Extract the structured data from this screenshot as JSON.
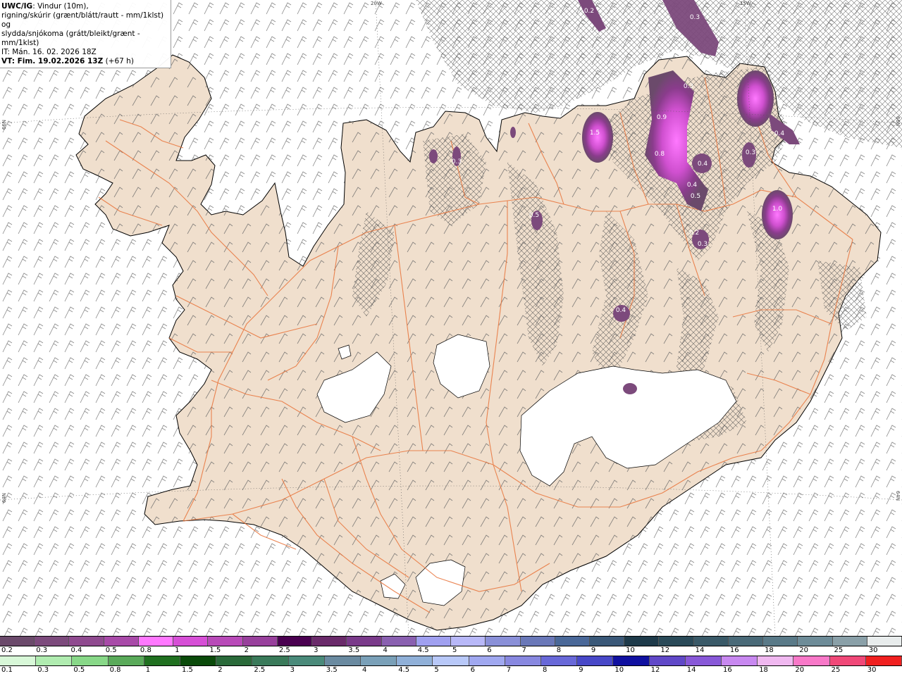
{
  "header": {
    "model": "UWC/IG",
    "line1": ": Vindur (10m),",
    "line2": "rigning/skúrir (grænt/blátt/rautt - mm/1klst) og",
    "line3": "slydda/snjókoma (grátt/bleikt/grænt - mm/1klst)",
    "it": "IT: Mán. 16. 02. 2026 18Z",
    "vt": "VT: Fim. 19.02.2026 13Z",
    "vt_suffix": " (+67 h)"
  },
  "coords": {
    "top_20w": "20W",
    "top_15w": "15W",
    "left_66n": "66N",
    "right_66n": "66N",
    "left_64n": "64N",
    "right_64n": "64N"
  },
  "colors": {
    "land": "#f0dfcd",
    "roads": "#e8733a",
    "glacier": "#ffffff",
    "snow_light": "#7d4b7f",
    "snow_mid": "#a64aa6",
    "snow_high": "#e65fe6",
    "ocean": "#ffffff"
  },
  "legend": {
    "snow": {
      "labels": [
        "0.2",
        "0.3",
        "0.4",
        "0.5",
        "0.8",
        "1",
        "1.5",
        "2",
        "2.5",
        "3",
        "3.5",
        "4",
        "4.5",
        "5",
        "6",
        "7",
        "8",
        "9",
        "10",
        "12",
        "14",
        "16",
        "18",
        "20",
        "25",
        "30"
      ],
      "colors": [
        "#6b4a6b",
        "#7c4a7c",
        "#8f4a8f",
        "#a84aa8",
        "#ff78ff",
        "#d64fd6",
        "#b84ab8",
        "#98409c",
        "#4a0050",
        "#6a2a6a",
        "#7a3a8a",
        "#8a60b0",
        "#a0a0f0",
        "#b8b8f8",
        "#8a90d8",
        "#6a78b8",
        "#4a6898",
        "#3a5878",
        "#1e3a4a",
        "#2a4a58",
        "#3a5a68",
        "#4a6a78",
        "#5a7a88",
        "#6e8c98",
        "#8aa0a8",
        "#e8ecec"
      ]
    },
    "rain": {
      "labels": [
        "0.1",
        "0.3",
        "0.5",
        "0.8",
        "1",
        "1.5",
        "2",
        "2.5",
        "3",
        "3.5",
        "4",
        "4.5",
        "5",
        "6",
        "7",
        "8",
        "9",
        "10",
        "12",
        "14",
        "16",
        "18",
        "20",
        "25",
        "30"
      ],
      "colors": [
        "#d8f8d8",
        "#b0ecb0",
        "#88d888",
        "#5aaa5a",
        "#207020",
        "#0a4a0a",
        "#2a6a3a",
        "#3a7a5a",
        "#4a8a7a",
        "#6a8aa0",
        "#7aa0b8",
        "#90b0d8",
        "#b8c8f8",
        "#a0a8f0",
        "#8888e0",
        "#6868d8",
        "#4848c8",
        "#1010a0",
        "#6048c8",
        "#8858d8",
        "#c888f0",
        "#f0b8f0",
        "#f878c8",
        "#f04878",
        "#f02020"
      ]
    }
  },
  "map_labels": [
    "0.2",
    "0.3",
    "0.3",
    "1.5",
    "0.9",
    "0.8",
    "0.4",
    "0.3",
    "0.4",
    "0.5",
    "1.0",
    "0.3",
    "0.2",
    "0.4",
    "0.3",
    "0.5",
    "0.4"
  ]
}
